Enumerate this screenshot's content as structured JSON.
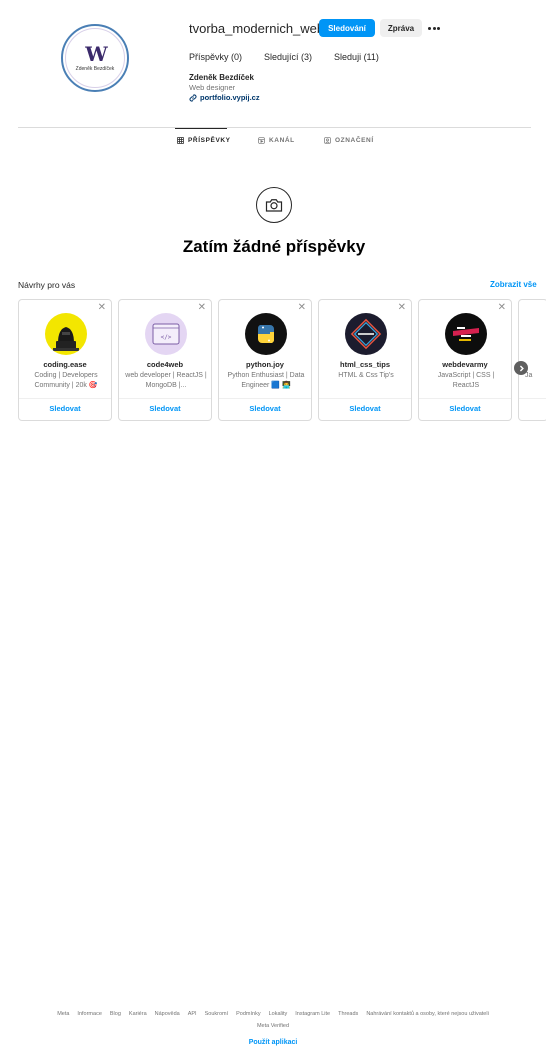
{
  "profile": {
    "username": "tvorba_modernich_webu",
    "following_button": "Sledování",
    "message_button": "Zpráva",
    "avatar_logo": "W",
    "avatar_name": "Zdeněk Bezdíček",
    "stats": {
      "posts": "Příspěvky (0)",
      "followers": "Sledující (3)",
      "following": "Sleduji (11)"
    },
    "full_name": "Zdeněk Bezdíček",
    "category": "Web designer",
    "link": "portfolio.vypij.cz"
  },
  "tabs": [
    {
      "label": "PŘÍSPĚVKY",
      "icon": "grid-icon",
      "active": true
    },
    {
      "label": "KANÁL",
      "icon": "reels-icon",
      "active": false
    },
    {
      "label": "OZNAČENÍ",
      "icon": "tagged-icon",
      "active": false
    }
  ],
  "empty_state": {
    "icon": "camera-icon",
    "title": "Zatím žádné příspěvky"
  },
  "suggestions": {
    "title": "Návrhy pro vás",
    "show_all": "Zobrazit vše",
    "cards": [
      {
        "name": "coding.ease",
        "bio": "Coding | Developers Community | 20k 🎯",
        "follow": "Sledovat",
        "pic_bg": "#f3e600"
      },
      {
        "name": "code4web",
        "bio": "web developer | ReactJS | MongoDB |...",
        "follow": "Sledovat",
        "pic_bg": "#d9c7ef"
      },
      {
        "name": "python.joy",
        "bio": "Python Enthusiast | Data Engineer 🟦 👨‍💻",
        "follow": "Sledovat",
        "pic_bg": "#111111"
      },
      {
        "name": "html_css_tips",
        "bio": "HTML & Css Tip's",
        "follow": "Sledovat",
        "pic_bg": "#1c1c2e"
      },
      {
        "name": "webdevarmy",
        "bio": "JavaScript | CSS | ReactJS",
        "follow": "Sledovat",
        "pic_bg": "#0d0d0d"
      },
      {
        "name": "",
        "bio": "Ja",
        "follow": "",
        "pic_bg": "#ffffff"
      }
    ]
  },
  "footer": {
    "links": [
      "Meta",
      "Informace",
      "Blog",
      "Kariéra",
      "Nápověda",
      "API",
      "Soukromí",
      "Podmínky",
      "Lokality",
      "Instagram Lite",
      "Threads",
      "Nahrávání kontaktů a osoby, které nejsou uživateli"
    ],
    "links_row2": [
      "Meta Verified"
    ],
    "use_app": "Použít aplikaci"
  },
  "colors": {
    "accent": "#0095f6",
    "text": "#262626",
    "secondary_text": "#737373",
    "border": "#dbdbdb"
  }
}
